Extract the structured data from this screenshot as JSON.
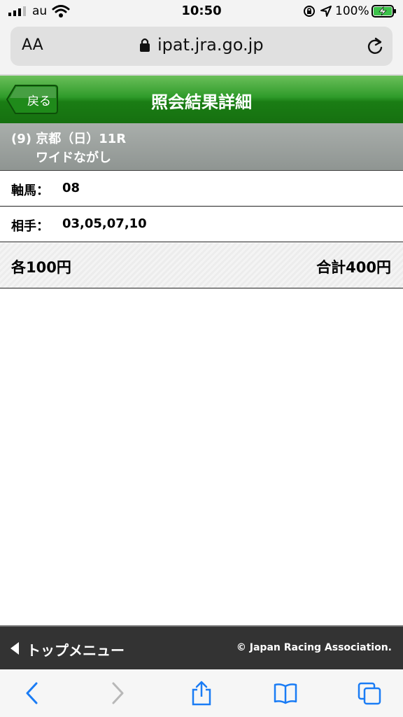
{
  "status_bar": {
    "carrier": "au",
    "time": "10:50",
    "battery_percent": "100%",
    "battery_level": 1.0,
    "icons": [
      "signal-icon",
      "wifi-icon",
      "rotation-lock-icon",
      "location-arrow-icon",
      "battery-charging-icon"
    ]
  },
  "browser": {
    "text_size_label": "AA",
    "url": "ipat.jra.go.jp"
  },
  "header": {
    "back_label": "戻る",
    "title": "照会結果詳細"
  },
  "race": {
    "line1": "(9) 京都（日）11R",
    "line2": "ワイドながし"
  },
  "details": {
    "axis_label": "軸馬：",
    "axis_value": "08",
    "partner_label": "相手：",
    "partner_value": "03,05,07,10"
  },
  "summary": {
    "each": "各100円",
    "total": "合計400円"
  },
  "footer": {
    "nav_label": "トップメニュー",
    "copyright": "© Japan Racing Association."
  },
  "toolbar": {
    "icons": [
      "back-icon",
      "forward-icon",
      "share-icon",
      "bookmarks-icon",
      "tabs-icon"
    ]
  },
  "colors": {
    "header_green": "#1a7d14",
    "race_gray": "#8f9592",
    "footer_dark": "#333333",
    "ios_blue": "#1a7cf5"
  }
}
